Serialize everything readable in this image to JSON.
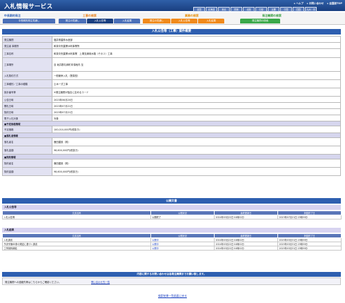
{
  "header": {
    "title": "入札情報サービス",
    "links": [
      "ヘルプ",
      "お問い合わせ",
      "全国版TOP"
    ],
    "regions": [
      "全国",
      "北海道",
      "東北",
      "関東",
      "北陸",
      "中部",
      "近畿",
      "中国",
      "四国",
      "九州・沖縄"
    ]
  },
  "menu": {
    "group_titles": [
      "中長期的発注",
      "工事の検索",
      "業務の検索",
      "発注機関の検索"
    ],
    "tabs": [
      "中長期的発注見通し",
      "発注の見通し",
      "入札公告等",
      "入札結果",
      "発注の見通し",
      "入札公告等",
      "入札結果",
      "発注機関の検索"
    ]
  },
  "main": {
    "title": "入札公告等（工事）案件概要",
    "rows": [
      {
        "label": "発注機関",
        "value": "福井県農林水産部"
      },
      {
        "label": "発注者 事務所",
        "value": "和泉中央農業水利事業所"
      },
      {
        "label": "工事名称",
        "value": "和泉中央農業水利事業　上場支線用水路（その２）工事"
      },
      {
        "label": "工事場所",
        "value": "自 坂井郡丸岡町本領地内 至"
      },
      {
        "label": "入札契約方式",
        "value": "一般競争入札（簡易型）"
      },
      {
        "label": "工事種別／工事の種類",
        "value": "土木一式工事"
      },
      {
        "label": "設計番号等",
        "value": "※発注機関が独自に定めるコード"
      },
      {
        "label": "公告日時",
        "value": "2023年06月20日"
      },
      {
        "label": "開札日時",
        "value": "2023年07月21日"
      },
      {
        "label": "契約日時",
        "value": "2023年07月21日"
      },
      {
        "label": "電子入札対象",
        "value": "対象"
      }
    ],
    "price_section": "■予定価格情報",
    "price_row": {
      "label": "予定価格",
      "value": "100,010,000円(税抜き)"
    },
    "winner_section": "■落札者情報",
    "winner_rows": [
      {
        "label": "落札者名",
        "value": "鹿田建設（株）"
      },
      {
        "label": "落札金額",
        "value": "98,600,000円(税抜き)"
      }
    ],
    "contract_section": "■契約情報",
    "contract_rows": [
      {
        "label": "契約者名",
        "value": "鹿田建設（株）"
      },
      {
        "label": "契約金額",
        "value": "98,600,000円(税抜き)"
      }
    ]
  },
  "documents": {
    "title": "公開文書",
    "sections": [
      {
        "name": "入札公告等",
        "headers": [
          "文書名称",
          "公開状況",
          "最終更新日",
          "掲載終了日"
        ],
        "rows": [
          [
            "入札公告等",
            "公開終了",
            "2024年03月22日 04時02分",
            "2023年07月21日 23時59分"
          ]
        ]
      },
      {
        "name": "入札結果",
        "headers": [
          "文書名称",
          "公開状況",
          "最終更新日",
          "掲載終了日"
        ],
        "rows": [
          [
            "入札調書",
            "公開中",
            "2024年03月22日 04時02分",
            "2025年03月31日 23時59分"
          ],
          [
            "予決令第85条の規定に基づく調書",
            "公開中",
            "2024年03月22日 04時02分",
            "2025年03月31日 23時59分"
          ],
          [
            "工事契約締結",
            "公開中",
            "2024年03月22日 04時02分",
            "2025年03月31日 23時59分"
          ]
        ]
      }
    ]
  },
  "inquiry": {
    "title": "内容に関するお問い合わせは各発注機関までお願い致します。",
    "text": "発注機関への連絡先等はこちらからご確認ください。",
    "link": "問い合わせ先一覧"
  },
  "back_link": "検索結果一覧画面に戻る"
}
